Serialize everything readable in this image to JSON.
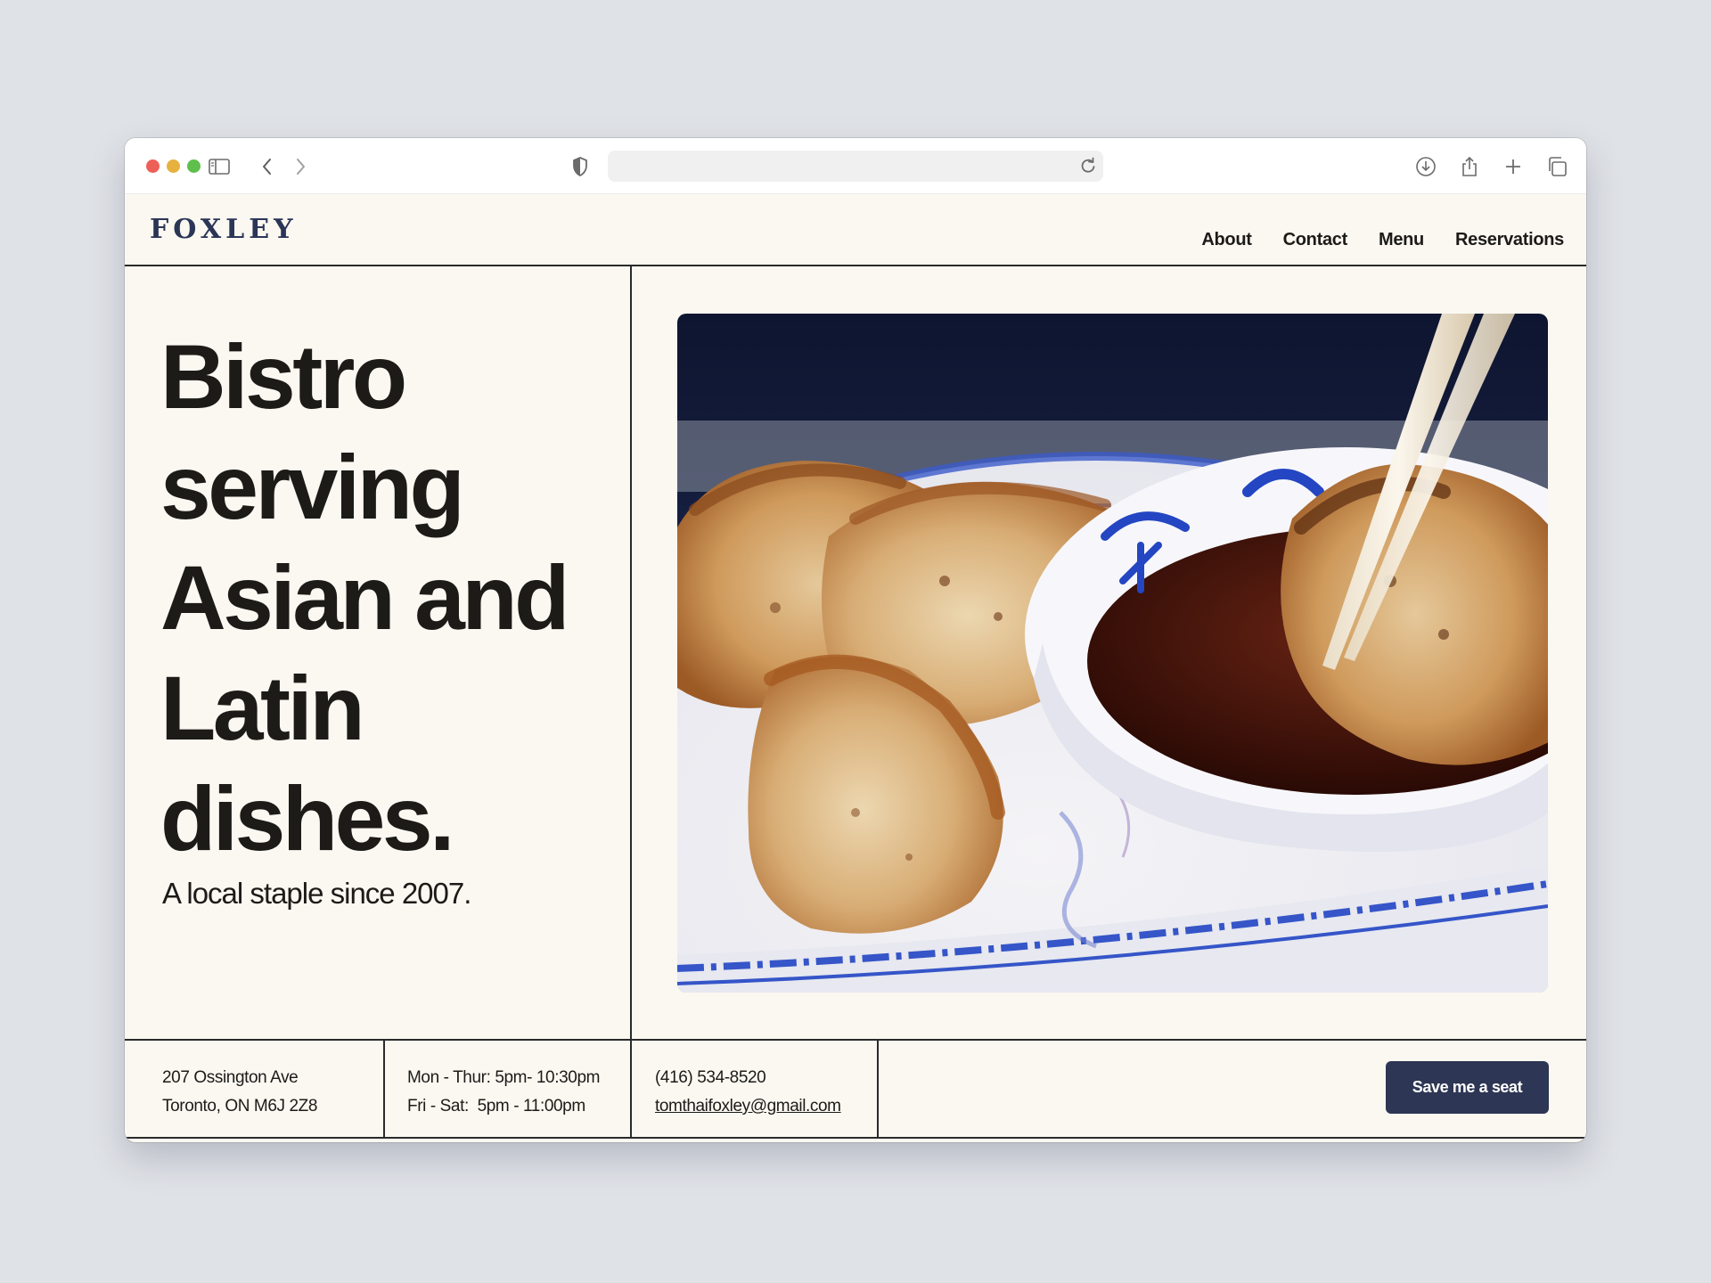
{
  "browser": {
    "icons": [
      "sidebar-icon",
      "back-icon",
      "forward-icon",
      "shield-icon",
      "reload-icon",
      "download-icon",
      "share-icon",
      "new-tab-icon",
      "tabs-overview-icon"
    ],
    "url": ""
  },
  "header": {
    "logo": "FOXLEY",
    "nav": [
      "About",
      "Contact",
      "Menu",
      "Reservations"
    ]
  },
  "hero": {
    "headline": "Bistro serving Asian and Latin dishes.",
    "tagline": "A local staple since 2007.",
    "image_subject": "fried dumplings on a blue-and-white plate with dipping sauce and chopsticks"
  },
  "footer": {
    "address": [
      "207 Ossington Ave",
      "Toronto, ON M6J 2Z8"
    ],
    "hours": [
      "Mon - Thur: 5pm- 10:30pm",
      "Fri - Sat:  5pm - 11:00pm"
    ],
    "phone": "(416) 534-8520",
    "email": "tomthaifoxley@gmail.com",
    "cta": "Save me a seat"
  },
  "colors": {
    "background": "#dfe2e7",
    "page": "#faf8f1",
    "brand": "#2b3556",
    "button": "#2d3654",
    "text": "#1d1b18"
  }
}
